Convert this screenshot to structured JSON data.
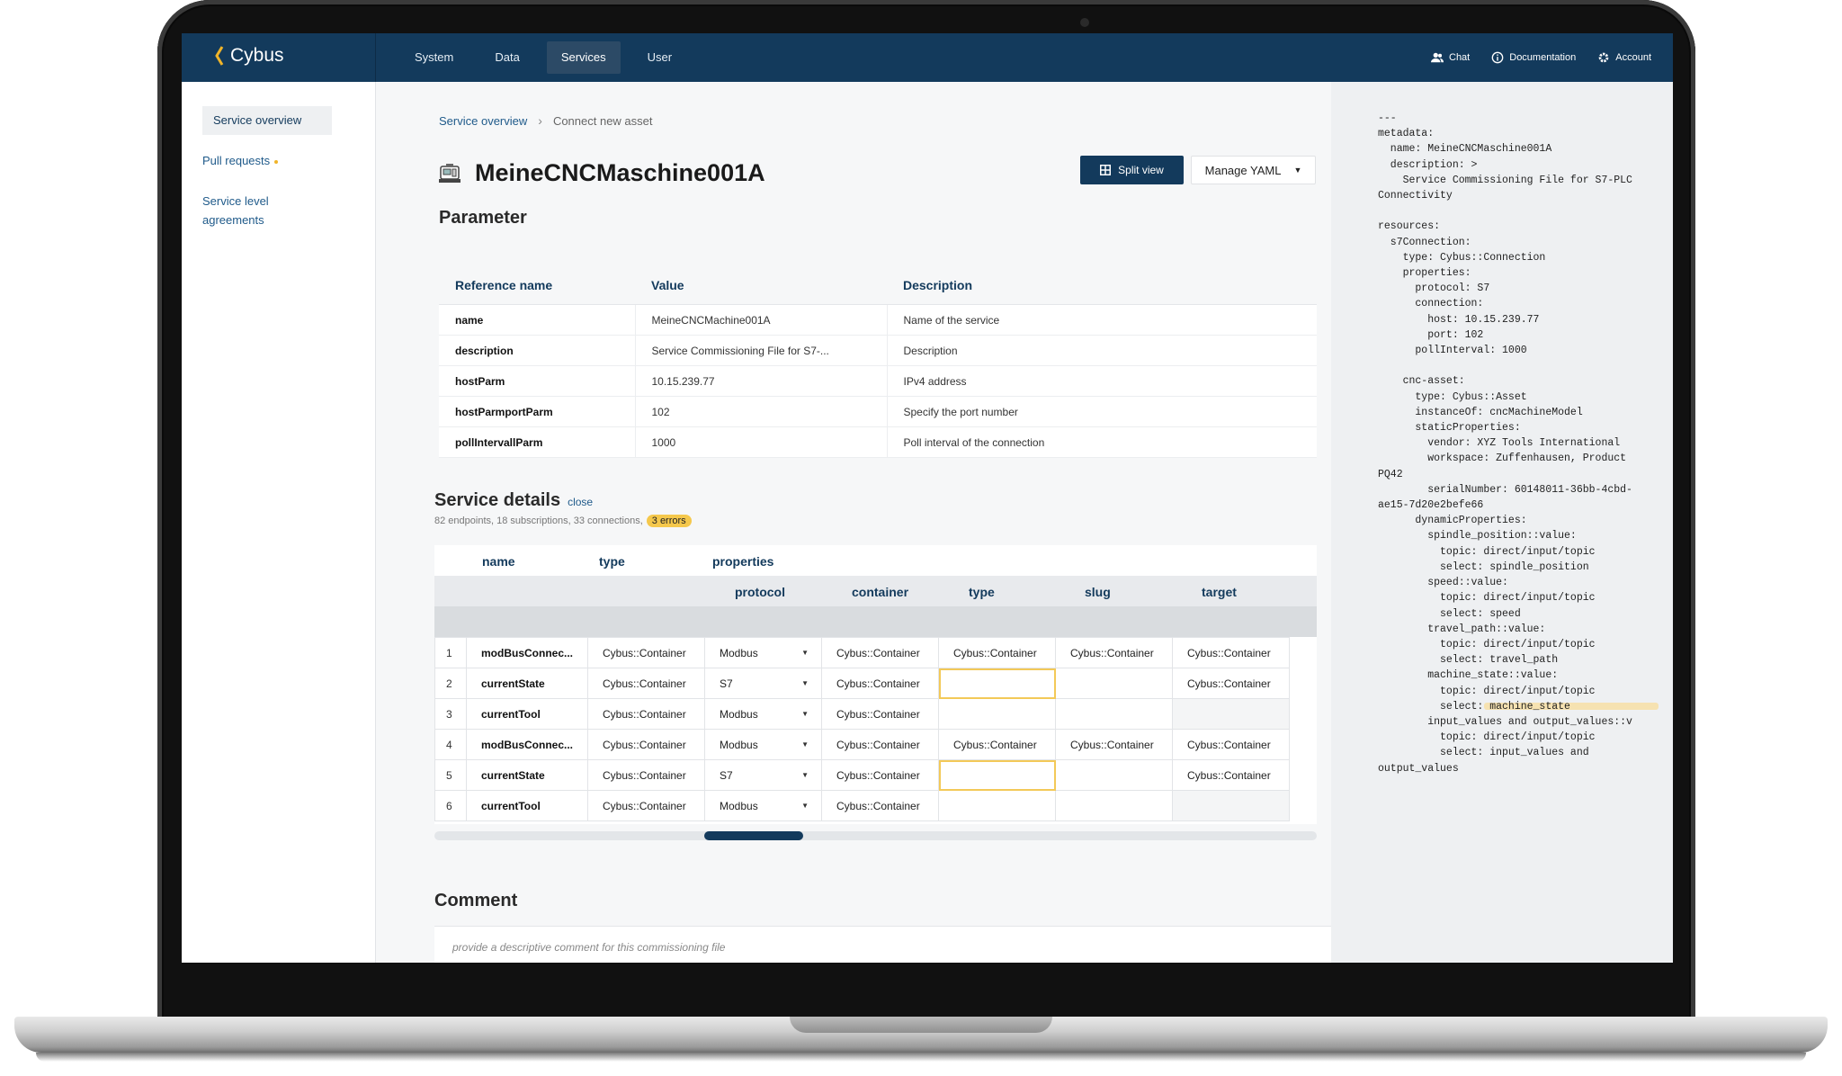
{
  "app": {
    "brand": "Cybus"
  },
  "topnav": {
    "items": [
      "System",
      "Data",
      "Services",
      "User"
    ],
    "active": "Services",
    "utils": {
      "chat": "Chat",
      "documentation": "Documentation",
      "account": "Account"
    }
  },
  "sidebar": {
    "items": [
      "Service overview",
      "Pull requests",
      "Service level agreements"
    ]
  },
  "breadcrumb": {
    "parent": "Service overview",
    "current": "Connect new asset"
  },
  "page": {
    "title": "MeineCNCMaschine001A",
    "split_view": "Split view",
    "manage_yaml": "Manage YAML"
  },
  "parameter": {
    "heading": "Parameter",
    "columns": [
      "Reference name",
      "Value",
      "Description"
    ],
    "rows": [
      [
        "name",
        "MeineCNCMachine001A",
        "Name of the service"
      ],
      [
        "description",
        "Service Commissioning File for S7-...",
        "Description"
      ],
      [
        "hostParm",
        "10.15.239.77",
        "IPv4 address"
      ],
      [
        "hostParmportParm",
        "102",
        "Specify the port number"
      ],
      [
        "pollIntervallParm",
        "1000",
        "Poll interval of the connection"
      ]
    ]
  },
  "service_details": {
    "heading": "Service details",
    "close": "close",
    "meta": "82 endpoints, 18 subscriptions, 33 connections,",
    "errors": "3 errors",
    "header_top": {
      "name": "name",
      "type": "type",
      "properties": "properties"
    },
    "header_sub": {
      "protocol": "protocol",
      "container": "container",
      "type": "type",
      "slug": "slug",
      "target": "target"
    },
    "rows": [
      [
        "1",
        "modBusConnec...",
        "Cybus::Container",
        "Modbus",
        "Cybus::Container",
        "Cybus::Container",
        "Cybus::Container",
        "Cybus::Container"
      ],
      [
        "2",
        "currentState",
        "Cybus::Container",
        "S7",
        "Cybus::Container",
        "",
        "",
        "Cybus::Container"
      ],
      [
        "3",
        "currentTool",
        "Cybus::Container",
        "Modbus",
        "Cybus::Container",
        "",
        "",
        ""
      ],
      [
        "4",
        "modBusConnec...",
        "Cybus::Container",
        "Modbus",
        "Cybus::Container",
        "Cybus::Container",
        "Cybus::Container",
        "Cybus::Container"
      ],
      [
        "5",
        "currentState",
        "Cybus::Container",
        "S7",
        "Cybus::Container",
        "",
        "",
        "Cybus::Container"
      ],
      [
        "6",
        "currentTool",
        "Cybus::Container",
        "Modbus",
        "Cybus::Container",
        "",
        "",
        ""
      ]
    ]
  },
  "comment": {
    "heading": "Comment",
    "placeholder": "provide a descriptive comment for this commissioning file"
  },
  "yaml": {
    "text": "---\nmetadata:\n  name: MeineCNCMaschine001A\n  description: >\n    Service Commissioning File for S7-PLC\nConnectivity\n\nresources:\n  s7Connection:\n    type: Cybus::Connection\n    properties:\n      protocol: S7\n      connection:\n        host: 10.15.239.77\n        port: 102\n      pollInterval: 1000\n\n    cnc-asset:\n      type: Cybus::Asset\n      instanceOf: cncMachineModel\n      staticProperties:\n        vendor: XYZ Tools International\n        workspace: Zuffenhausen, Product\nPQ42\n        serialNumber: 60148011-36bb-4cbd-\nae15-7d20e2befe66\n      dynamicProperties:\n        spindle_position::value:\n          topic: direct/input/topic\n          select: spindle_position\n        speed::value:\n          topic: direct/input/topic\n          select: speed\n        travel_path::value:\n          topic: direct/input/topic\n          select: travel_path\n        machine_state::value:\n          topic: direct/input/topic\n          select: machine_state\n        input_values and output_values::v\n          topic: direct/input/topic\n          select: input_values and\noutput_values"
  }
}
